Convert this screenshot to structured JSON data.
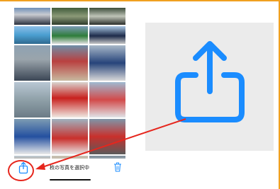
{
  "toolbar": {
    "selection_text": "枚の写真を選択中",
    "share_icon": "share-icon",
    "trash_icon": "trash-icon"
  },
  "photos": [
    "photo-1",
    "photo-2",
    "photo-3",
    "photo-4",
    "photo-5",
    "photo-6",
    "photo-7",
    "photo-8",
    "photo-9",
    "photo-10",
    "photo-11",
    "photo-12",
    "photo-13",
    "photo-14",
    "photo-15",
    "photo-16",
    "photo-17",
    "photo-18"
  ],
  "annotation": {
    "highlight_color": "#e6261d",
    "frame_color": "#f0a020",
    "zoom_icon": "share-icon",
    "ios_blue": "#1a8cff"
  }
}
